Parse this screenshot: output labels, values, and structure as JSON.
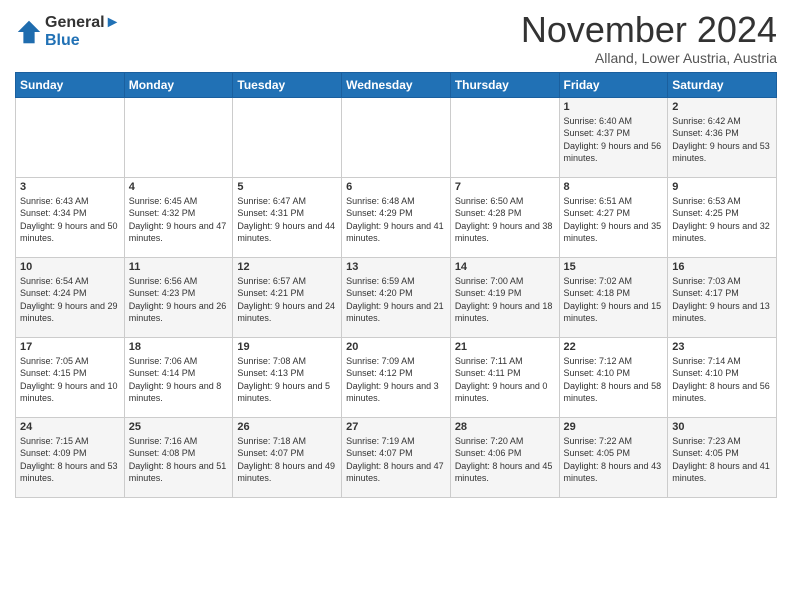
{
  "header": {
    "logo_line1": "General",
    "logo_line2": "Blue",
    "month_title": "November 2024",
    "subtitle": "Alland, Lower Austria, Austria"
  },
  "days_of_week": [
    "Sunday",
    "Monday",
    "Tuesday",
    "Wednesday",
    "Thursday",
    "Friday",
    "Saturday"
  ],
  "weeks": [
    [
      {
        "num": "",
        "sunrise": "",
        "sunset": "",
        "daylight": ""
      },
      {
        "num": "",
        "sunrise": "",
        "sunset": "",
        "daylight": ""
      },
      {
        "num": "",
        "sunrise": "",
        "sunset": "",
        "daylight": ""
      },
      {
        "num": "",
        "sunrise": "",
        "sunset": "",
        "daylight": ""
      },
      {
        "num": "",
        "sunrise": "",
        "sunset": "",
        "daylight": ""
      },
      {
        "num": "1",
        "sunrise": "Sunrise: 6:40 AM",
        "sunset": "Sunset: 4:37 PM",
        "daylight": "Daylight: 9 hours and 56 minutes."
      },
      {
        "num": "2",
        "sunrise": "Sunrise: 6:42 AM",
        "sunset": "Sunset: 4:36 PM",
        "daylight": "Daylight: 9 hours and 53 minutes."
      }
    ],
    [
      {
        "num": "3",
        "sunrise": "Sunrise: 6:43 AM",
        "sunset": "Sunset: 4:34 PM",
        "daylight": "Daylight: 9 hours and 50 minutes."
      },
      {
        "num": "4",
        "sunrise": "Sunrise: 6:45 AM",
        "sunset": "Sunset: 4:32 PM",
        "daylight": "Daylight: 9 hours and 47 minutes."
      },
      {
        "num": "5",
        "sunrise": "Sunrise: 6:47 AM",
        "sunset": "Sunset: 4:31 PM",
        "daylight": "Daylight: 9 hours and 44 minutes."
      },
      {
        "num": "6",
        "sunrise": "Sunrise: 6:48 AM",
        "sunset": "Sunset: 4:29 PM",
        "daylight": "Daylight: 9 hours and 41 minutes."
      },
      {
        "num": "7",
        "sunrise": "Sunrise: 6:50 AM",
        "sunset": "Sunset: 4:28 PM",
        "daylight": "Daylight: 9 hours and 38 minutes."
      },
      {
        "num": "8",
        "sunrise": "Sunrise: 6:51 AM",
        "sunset": "Sunset: 4:27 PM",
        "daylight": "Daylight: 9 hours and 35 minutes."
      },
      {
        "num": "9",
        "sunrise": "Sunrise: 6:53 AM",
        "sunset": "Sunset: 4:25 PM",
        "daylight": "Daylight: 9 hours and 32 minutes."
      }
    ],
    [
      {
        "num": "10",
        "sunrise": "Sunrise: 6:54 AM",
        "sunset": "Sunset: 4:24 PM",
        "daylight": "Daylight: 9 hours and 29 minutes."
      },
      {
        "num": "11",
        "sunrise": "Sunrise: 6:56 AM",
        "sunset": "Sunset: 4:23 PM",
        "daylight": "Daylight: 9 hours and 26 minutes."
      },
      {
        "num": "12",
        "sunrise": "Sunrise: 6:57 AM",
        "sunset": "Sunset: 4:21 PM",
        "daylight": "Daylight: 9 hours and 24 minutes."
      },
      {
        "num": "13",
        "sunrise": "Sunrise: 6:59 AM",
        "sunset": "Sunset: 4:20 PM",
        "daylight": "Daylight: 9 hours and 21 minutes."
      },
      {
        "num": "14",
        "sunrise": "Sunrise: 7:00 AM",
        "sunset": "Sunset: 4:19 PM",
        "daylight": "Daylight: 9 hours and 18 minutes."
      },
      {
        "num": "15",
        "sunrise": "Sunrise: 7:02 AM",
        "sunset": "Sunset: 4:18 PM",
        "daylight": "Daylight: 9 hours and 15 minutes."
      },
      {
        "num": "16",
        "sunrise": "Sunrise: 7:03 AM",
        "sunset": "Sunset: 4:17 PM",
        "daylight": "Daylight: 9 hours and 13 minutes."
      }
    ],
    [
      {
        "num": "17",
        "sunrise": "Sunrise: 7:05 AM",
        "sunset": "Sunset: 4:15 PM",
        "daylight": "Daylight: 9 hours and 10 minutes."
      },
      {
        "num": "18",
        "sunrise": "Sunrise: 7:06 AM",
        "sunset": "Sunset: 4:14 PM",
        "daylight": "Daylight: 9 hours and 8 minutes."
      },
      {
        "num": "19",
        "sunrise": "Sunrise: 7:08 AM",
        "sunset": "Sunset: 4:13 PM",
        "daylight": "Daylight: 9 hours and 5 minutes."
      },
      {
        "num": "20",
        "sunrise": "Sunrise: 7:09 AM",
        "sunset": "Sunset: 4:12 PM",
        "daylight": "Daylight: 9 hours and 3 minutes."
      },
      {
        "num": "21",
        "sunrise": "Sunrise: 7:11 AM",
        "sunset": "Sunset: 4:11 PM",
        "daylight": "Daylight: 9 hours and 0 minutes."
      },
      {
        "num": "22",
        "sunrise": "Sunrise: 7:12 AM",
        "sunset": "Sunset: 4:10 PM",
        "daylight": "Daylight: 8 hours and 58 minutes."
      },
      {
        "num": "23",
        "sunrise": "Sunrise: 7:14 AM",
        "sunset": "Sunset: 4:10 PM",
        "daylight": "Daylight: 8 hours and 56 minutes."
      }
    ],
    [
      {
        "num": "24",
        "sunrise": "Sunrise: 7:15 AM",
        "sunset": "Sunset: 4:09 PM",
        "daylight": "Daylight: 8 hours and 53 minutes."
      },
      {
        "num": "25",
        "sunrise": "Sunrise: 7:16 AM",
        "sunset": "Sunset: 4:08 PM",
        "daylight": "Daylight: 8 hours and 51 minutes."
      },
      {
        "num": "26",
        "sunrise": "Sunrise: 7:18 AM",
        "sunset": "Sunset: 4:07 PM",
        "daylight": "Daylight: 8 hours and 49 minutes."
      },
      {
        "num": "27",
        "sunrise": "Sunrise: 7:19 AM",
        "sunset": "Sunset: 4:07 PM",
        "daylight": "Daylight: 8 hours and 47 minutes."
      },
      {
        "num": "28",
        "sunrise": "Sunrise: 7:20 AM",
        "sunset": "Sunset: 4:06 PM",
        "daylight": "Daylight: 8 hours and 45 minutes."
      },
      {
        "num": "29",
        "sunrise": "Sunrise: 7:22 AM",
        "sunset": "Sunset: 4:05 PM",
        "daylight": "Daylight: 8 hours and 43 minutes."
      },
      {
        "num": "30",
        "sunrise": "Sunrise: 7:23 AM",
        "sunset": "Sunset: 4:05 PM",
        "daylight": "Daylight: 8 hours and 41 minutes."
      }
    ]
  ]
}
